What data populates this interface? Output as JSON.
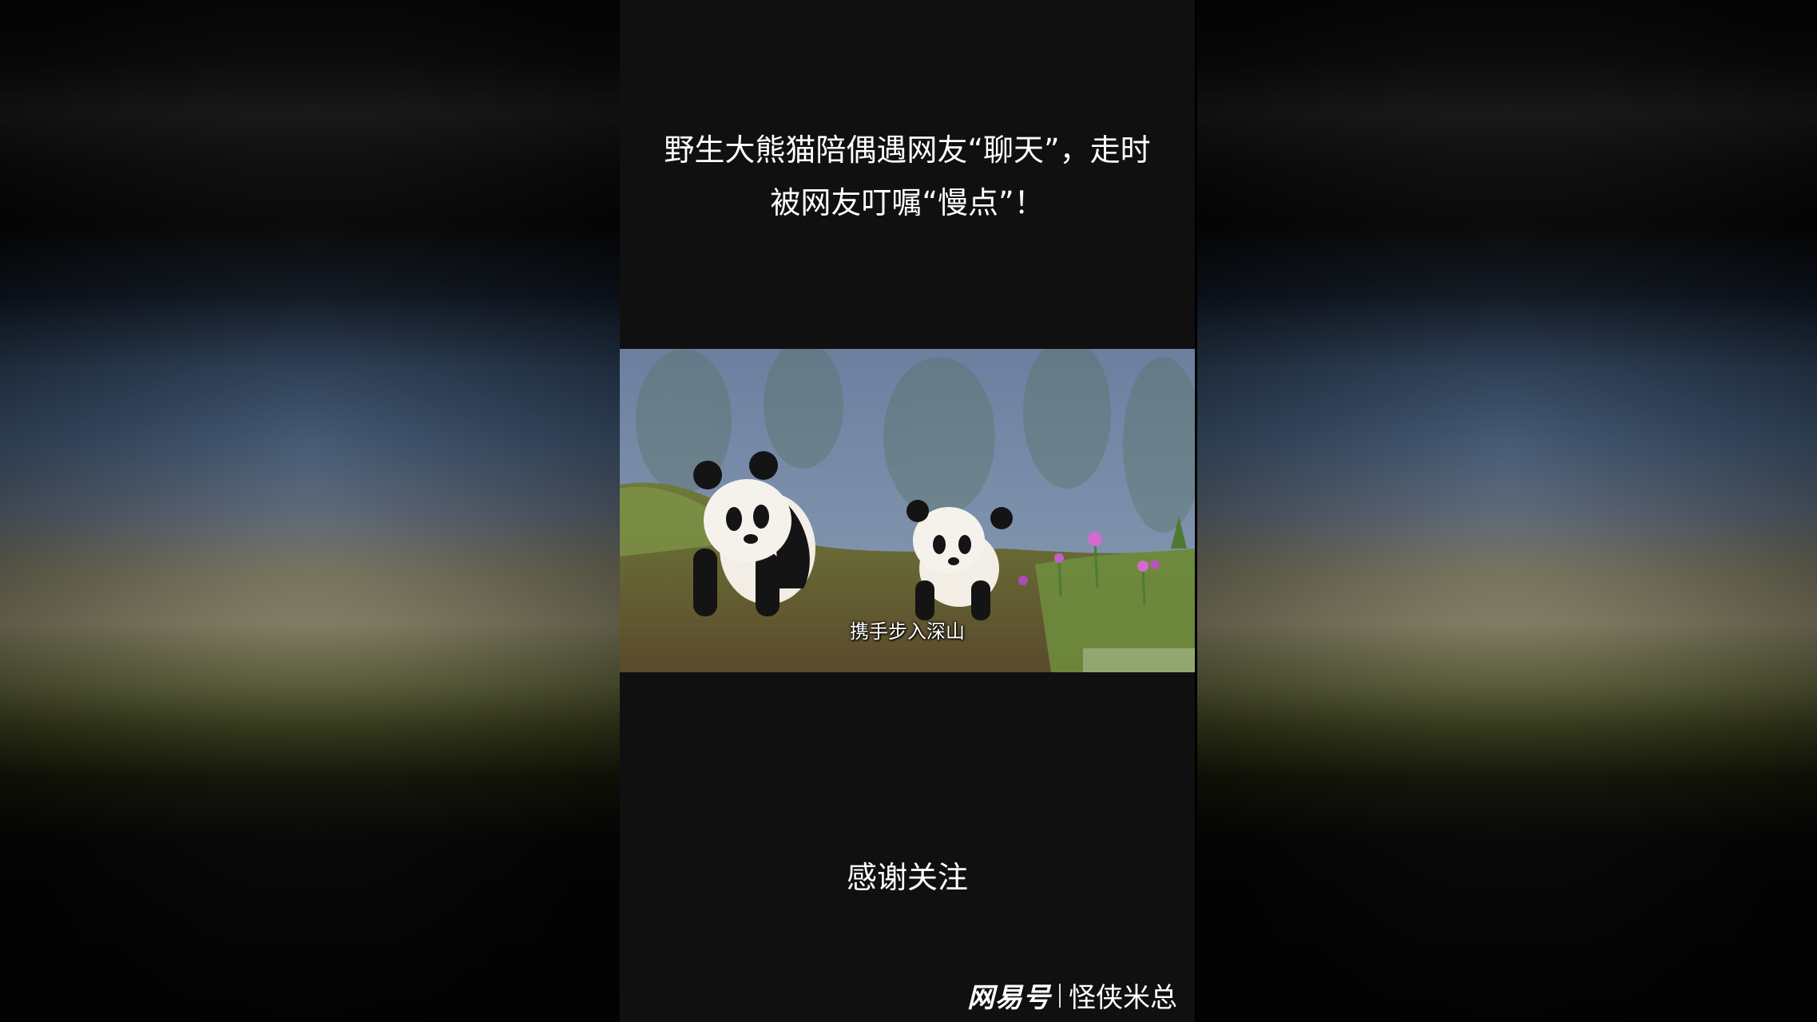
{
  "title": {
    "line1": "野生大熊猫陪偶遇网友“聊天”，走时",
    "line2": "被网友叮嘱“慢点”！"
  },
  "video": {
    "subtitle": "携手步入深山"
  },
  "footer": {
    "thanks": "感谢关注"
  },
  "watermark": {
    "brand": "网易号",
    "author": "怪侠米总"
  }
}
